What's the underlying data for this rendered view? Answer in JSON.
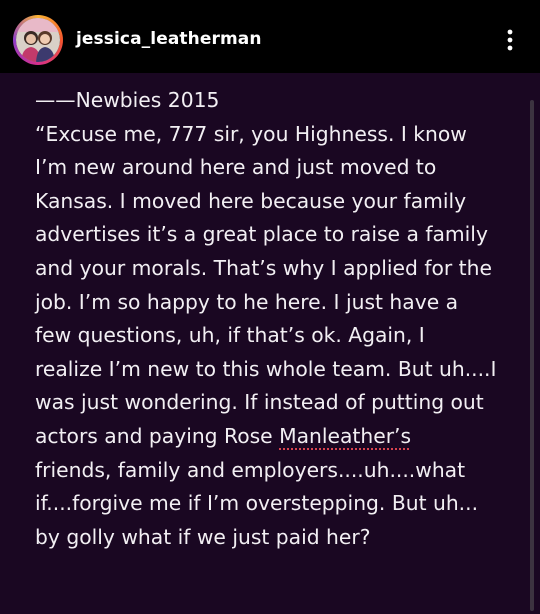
{
  "header": {
    "username": "jessica_leatherman",
    "avatar_icon": "profile-photo",
    "more_icon": "vertical-ellipsis-icon",
    "avatar_ring_colors": [
      "#f9b233",
      "#f4562d",
      "#d62f8c",
      "#8e3ec8"
    ]
  },
  "post": {
    "background": "#1a0722",
    "text_color": "#f2eff3",
    "lines": {
      "l1": "——Newbies 2015",
      "l2": "“Excuse me, 777 sir, you Highness. I know",
      "l3": "I’m new around here and just moved to",
      "l4": "Kansas. I moved here because your family",
      "l5": "advertises it’s a great place to raise a family",
      "l6": "and your morals. That’s why I applied for the",
      "l7": "job. I’m so happy to he here. I just have a",
      "l8": "few questions, uh, if that’s ok. Again, I",
      "l9": "realize I’m new to this whole team. But uh....I",
      "l10": "was just wondering. If instead of putting out",
      "l11_pre": "actors and paying Rose ",
      "l11_flag": "Manleather’s",
      "l12": "friends, family and employers....uh....what",
      "l13": "if....forgive me if I’m overstepping. But uh...",
      "l14": "by golly what if we just paid her?"
    }
  }
}
